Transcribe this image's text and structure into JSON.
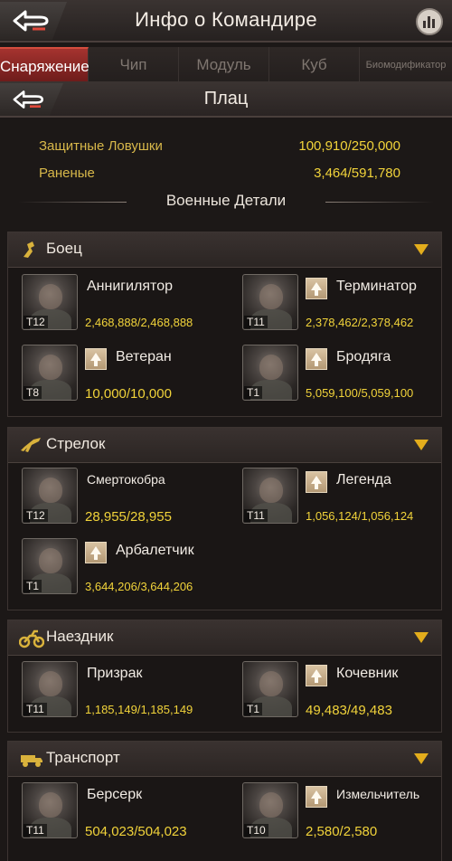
{
  "header": {
    "title": "Инфо о Командире"
  },
  "tabs": [
    {
      "label": "Снаряжение",
      "active": true
    },
    {
      "label": "Чип"
    },
    {
      "label": "Модуль"
    },
    {
      "label": "Куб"
    },
    {
      "label": "Биомодификатор"
    }
  ],
  "subheader": {
    "title": "Плац"
  },
  "stats": [
    {
      "label": "Защитные Ловушки",
      "value": "100,910/250,000"
    },
    {
      "label": "Раненые",
      "value": "3,464/591,780"
    }
  ],
  "military_title": "Военные Детали",
  "sections": [
    {
      "name": "Боец",
      "icon": "fighter-icon",
      "units": [
        {
          "name": "Аннигилятор",
          "tier": "T12",
          "count": "2,468,888/2,468,888",
          "upgrade": false
        },
        {
          "name": "Терминатор",
          "tier": "T11",
          "count": "2,378,462/2,378,462",
          "upgrade": true
        },
        {
          "name": "Ветеран",
          "tier": "T8",
          "count": "10,000/10,000",
          "upgrade": true
        },
        {
          "name": "Бродяга",
          "tier": "T1",
          "count": "5,059,100/5,059,100",
          "upgrade": true
        }
      ]
    },
    {
      "name": "Стрелок",
      "icon": "rifle-icon",
      "units": [
        {
          "name": "Смертокобра",
          "tier": "T12",
          "count": "28,955/28,955",
          "upgrade": false
        },
        {
          "name": "Легенда",
          "tier": "T11",
          "count": "1,056,124/1,056,124",
          "upgrade": true
        },
        {
          "name": "Арбалетчик",
          "tier": "T1",
          "count": "3,644,206/3,644,206",
          "upgrade": true
        }
      ]
    },
    {
      "name": "Наездник",
      "icon": "motorcycle-icon",
      "units": [
        {
          "name": "Призрак",
          "tier": "T11",
          "count": "1,185,149/1,185,149",
          "upgrade": false
        },
        {
          "name": "Кочевник",
          "tier": "T1",
          "count": "49,483/49,483",
          "upgrade": true
        }
      ]
    },
    {
      "name": "Транспорт",
      "icon": "truck-icon",
      "units": [
        {
          "name": "Берсерк",
          "tier": "T11",
          "count": "504,023/504,023",
          "upgrade": false
        },
        {
          "name": "Измельчитель",
          "tier": "T10",
          "count": "2,580/2,580",
          "upgrade": true
        }
      ]
    }
  ]
}
